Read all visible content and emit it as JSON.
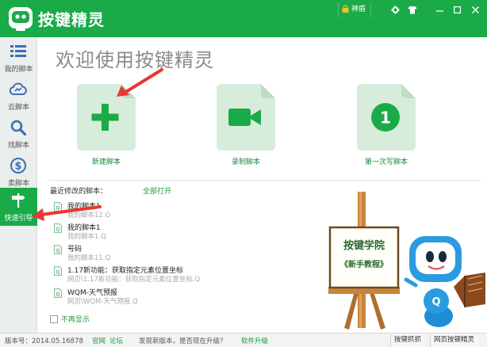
{
  "app": {
    "title": "按键精灵"
  },
  "titlebar": {
    "shield_label": "神盾"
  },
  "sidebar": {
    "items": [
      {
        "label": "我的脚本",
        "icon": "list-icon"
      },
      {
        "label": "云脚本",
        "icon": "cloud-icon"
      },
      {
        "label": "找脚本",
        "icon": "search-icon"
      },
      {
        "label": "卖脚本",
        "icon": "dollar-icon"
      },
      {
        "label": "快速引导",
        "icon": "signpost-icon",
        "active": true
      }
    ]
  },
  "main": {
    "welcome": "欢迎使用按键精灵",
    "cards": [
      {
        "label": "新建脚本",
        "icon": "plus-icon"
      },
      {
        "label": "录制脚本",
        "icon": "video-camera-icon"
      },
      {
        "label": "第一次写脚本",
        "icon": "number-one-icon",
        "number": "1"
      }
    ],
    "recent_title": "最近修改的脚本：",
    "open_all": "全部打开",
    "recent": [
      {
        "name": "我的脚本1",
        "path": "我的脚本12.Q"
      },
      {
        "name": "我的脚本1",
        "path": "我的脚本1.Q"
      },
      {
        "name": "号码",
        "path": "我的脚本11.Q"
      },
      {
        "name": "1.17新功能：获取指定元素位置坐标",
        "path": "网页\\1.17新功能：获取指定元素位置坐标.Q"
      },
      {
        "name": "WQM-天气预报",
        "path": "网页\\WQM-天气预报.Q"
      }
    ],
    "no_show": "不再显示"
  },
  "academy": {
    "title": "按键学院",
    "subtitle": "《新手教程》"
  },
  "statusbar": {
    "version": "版本号：2014.05.16878",
    "website": "官网",
    "forum": "论坛",
    "update_notice": "发现新版本，是否现在升级？",
    "upgrade_link": "软件升级",
    "btn_capture": "按键抓抓",
    "btn_web": "网页按键精灵"
  },
  "colors": {
    "brand": "#1aab48",
    "card_bg": "#d8ecdc",
    "card_icon": "#1aab48",
    "arrow": "#e53935"
  }
}
